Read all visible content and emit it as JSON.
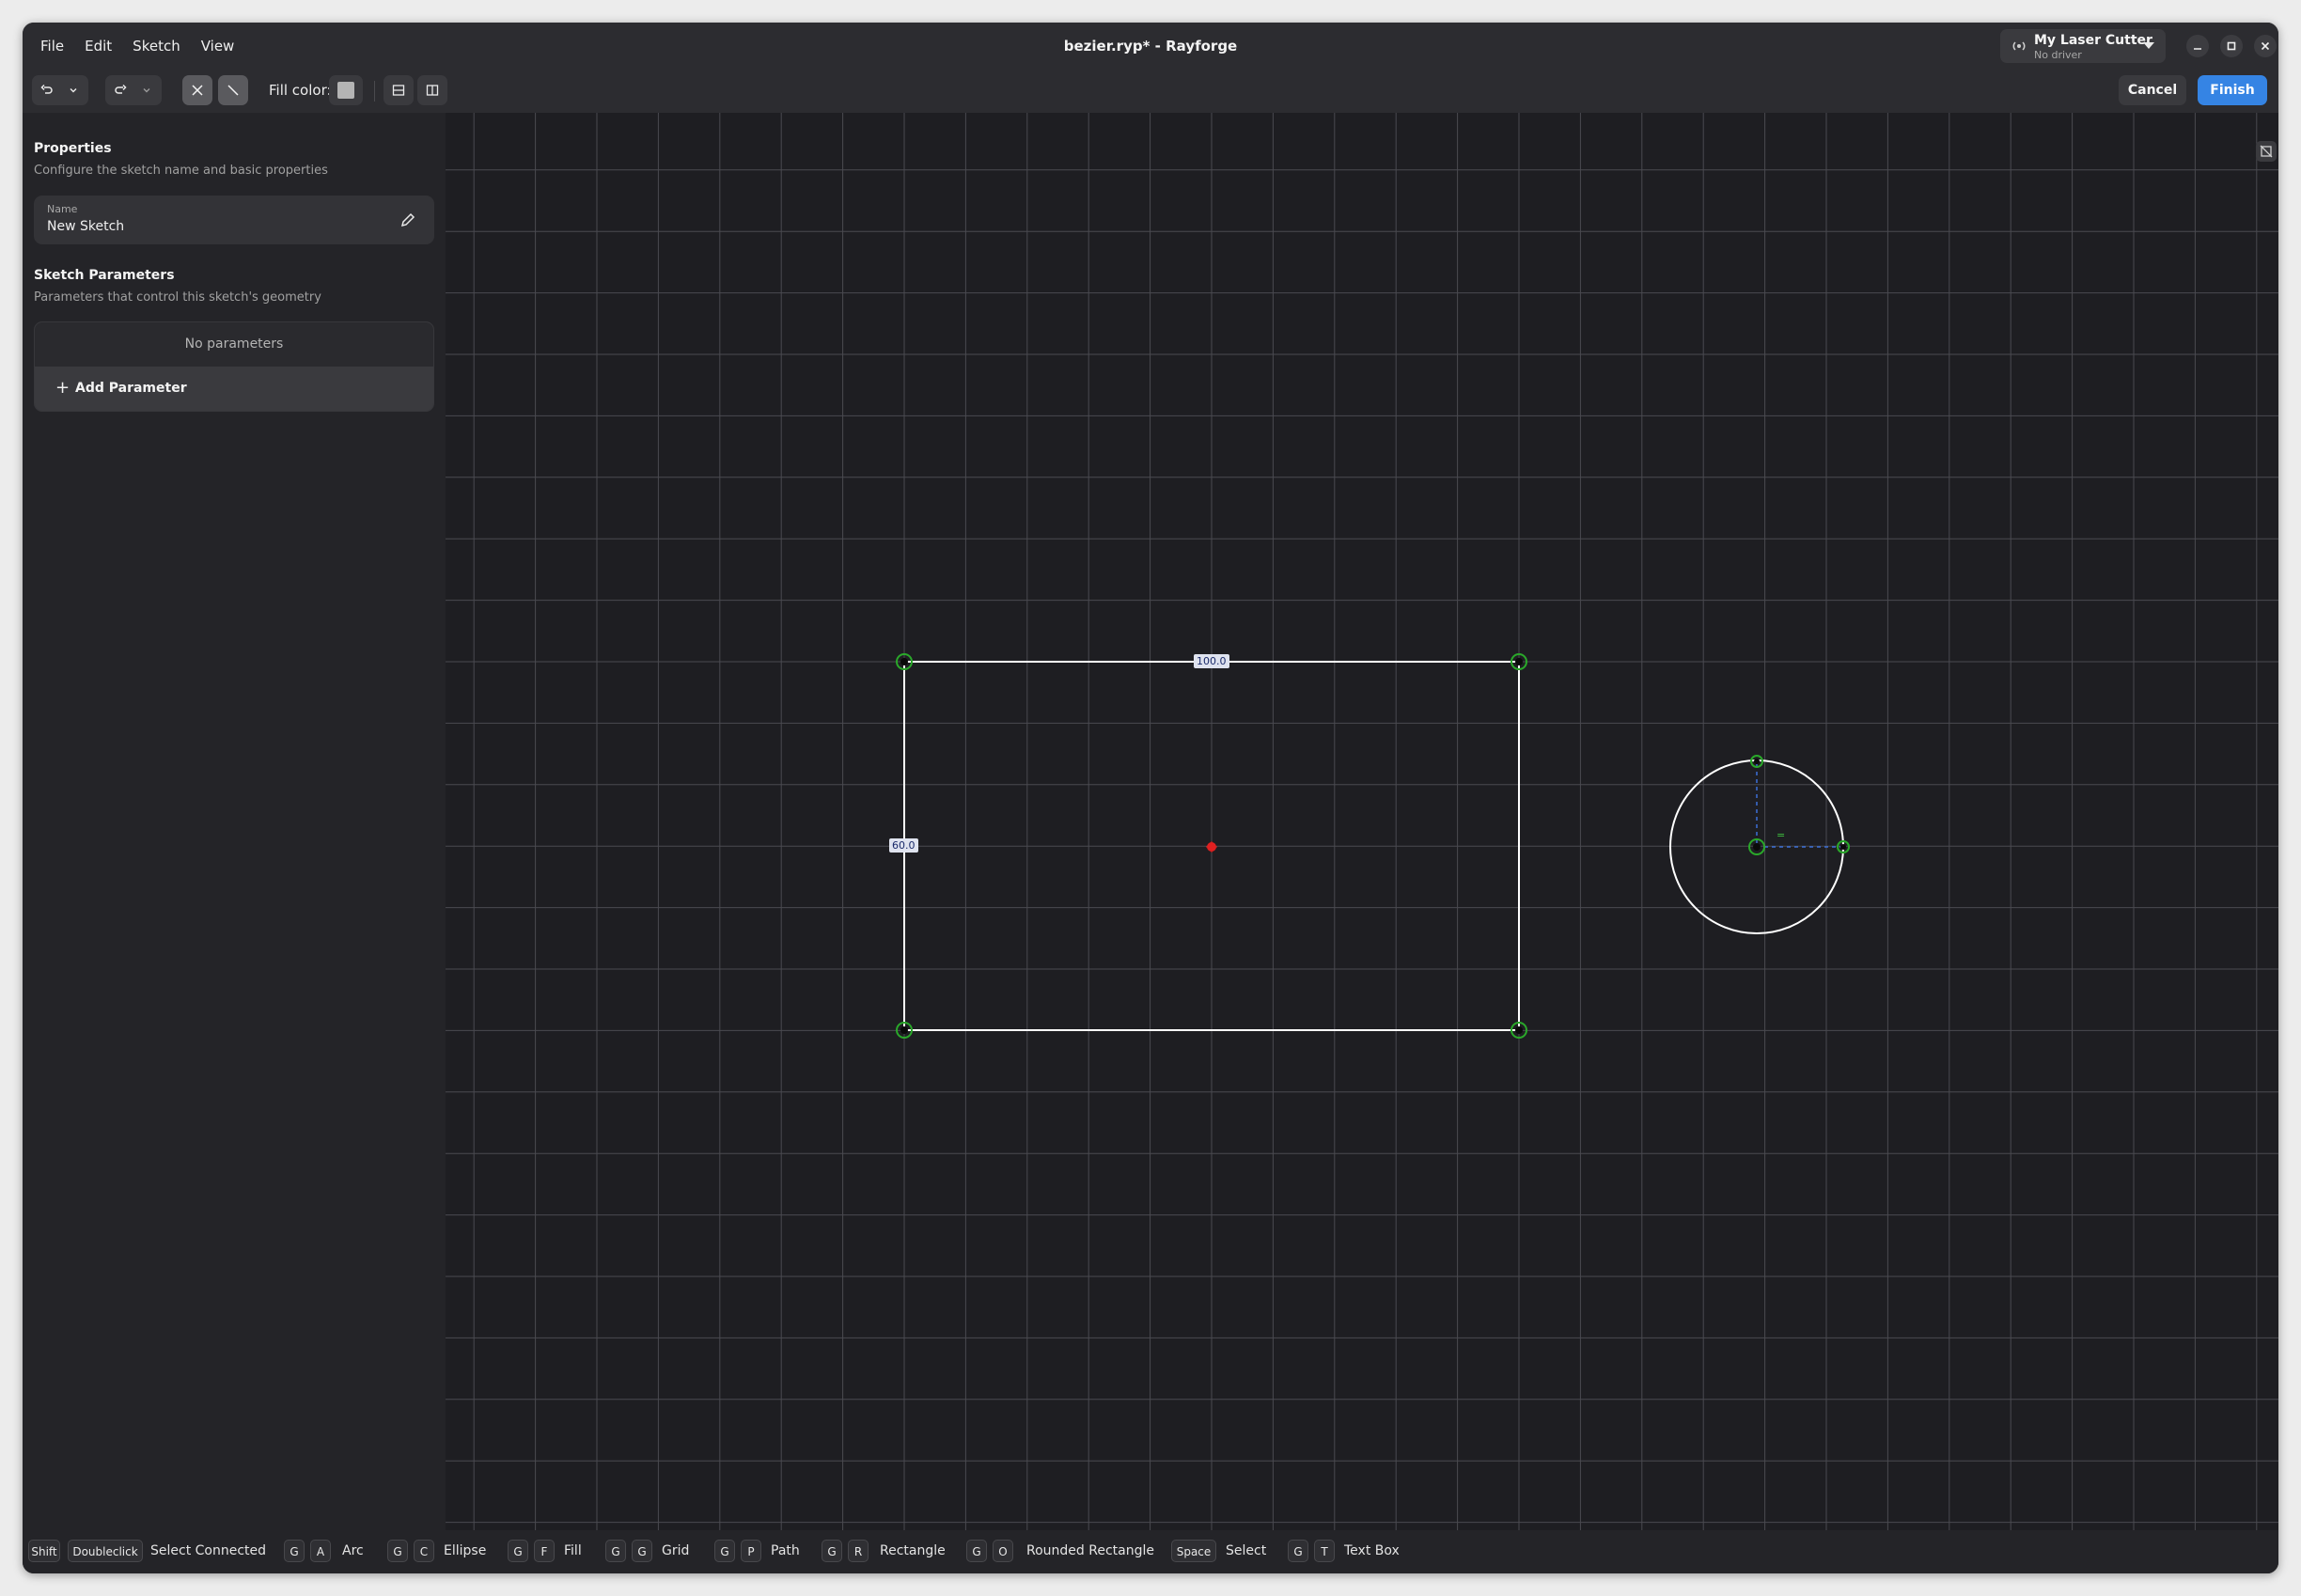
{
  "window": {
    "title": "bezier.ryp* - Rayforge"
  },
  "menu": [
    "File",
    "Edit",
    "Sketch",
    "View"
  ],
  "device": {
    "name": "My Laser Cutter",
    "status": "No driver"
  },
  "toolbar": {
    "fill_label": "Fill color:",
    "fill_color": "#b4b4b4",
    "cancel_label": "Cancel",
    "finish_label": "Finish"
  },
  "properties": {
    "title": "Properties",
    "subtitle": "Configure the sketch name and basic properties",
    "name_label": "Name",
    "name_value": "New Sketch"
  },
  "sketch_parameters": {
    "title": "Sketch Parameters",
    "subtitle": "Parameters that control this sketch's geometry",
    "empty_text": "No parameters",
    "add_label": "Add Parameter"
  },
  "canvas": {
    "width_dimension": "100.0",
    "height_dimension": "60.0",
    "equal_constraint": "="
  },
  "shortcuts": [
    {
      "keys": [
        "Shift",
        "Doubleclick"
      ],
      "action": "Select Connected"
    },
    {
      "keys": [
        "G",
        "A"
      ],
      "action": "Arc"
    },
    {
      "keys": [
        "G",
        "C"
      ],
      "action": "Ellipse"
    },
    {
      "keys": [
        "G",
        "F"
      ],
      "action": "Fill"
    },
    {
      "keys": [
        "G",
        "G"
      ],
      "action": "Grid"
    },
    {
      "keys": [
        "G",
        "P"
      ],
      "action": "Path"
    },
    {
      "keys": [
        "G",
        "R"
      ],
      "action": "Rectangle"
    },
    {
      "keys": [
        "G",
        "O"
      ],
      "action": "Rounded Rectangle"
    },
    {
      "keys": [
        "Space"
      ],
      "action": "Select"
    },
    {
      "keys": [
        "G",
        "T"
      ],
      "action": "Text Box"
    }
  ],
  "colors": {
    "accent": "#3584e4",
    "canvas_bg": "#1e1e22",
    "grid": "#4a4a50",
    "geometry": "#ffffff",
    "point": "#2aa82a",
    "construction": "#3b6fd8",
    "origin": "#e02020"
  }
}
